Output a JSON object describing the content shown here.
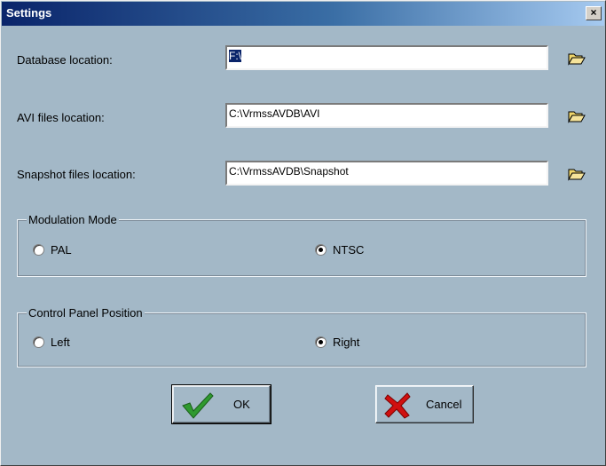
{
  "window": {
    "title": "Settings",
    "close_label": "×"
  },
  "fields": {
    "database": {
      "label": "Database location:",
      "value": "F:\\"
    },
    "avi": {
      "label": "AVI files location:",
      "value": "C:\\VrmssAVDB\\AVI"
    },
    "snapshot": {
      "label": "Snapshot files location:",
      "value": "C:\\VrmssAVDB\\Snapshot"
    }
  },
  "modulation": {
    "legend": "Modulation Mode",
    "options": [
      {
        "label": "PAL",
        "selected": false
      },
      {
        "label": "NTSC",
        "selected": true
      }
    ]
  },
  "panel_position": {
    "legend": "Control Panel Position",
    "options": [
      {
        "label": "Left",
        "selected": false
      },
      {
        "label": "Right",
        "selected": true
      }
    ]
  },
  "buttons": {
    "ok_label": "OK",
    "cancel_label": "Cancel"
  },
  "colors": {
    "background": "#a3b8c7",
    "title_start": "#0a246a",
    "title_end": "#a6caf0",
    "ok_check": "#2f9a2f",
    "cancel_x": "#d01010",
    "folder": "#f0d66a"
  },
  "icons": {
    "browse": "folder-open-icon",
    "ok": "checkmark-icon",
    "cancel": "red-x-icon"
  }
}
